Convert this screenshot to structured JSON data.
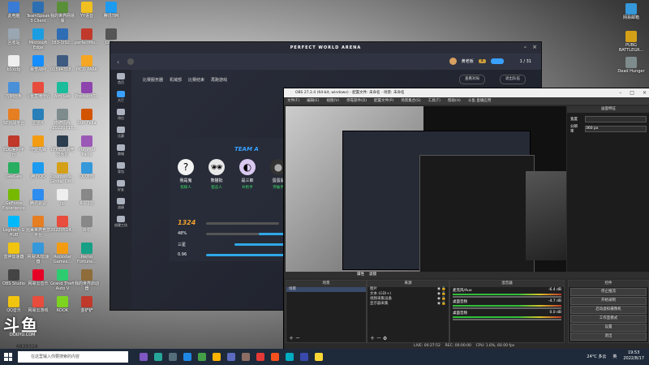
{
  "desktop": {
    "left_icons": [
      {
        "label": "此电脑",
        "color": "#3a7bd5"
      },
      {
        "label": "TeamSpeak 3 Client",
        "color": "#2c6fb3"
      },
      {
        "label": "我的世界网易版",
        "color": "#5a8f3a"
      },
      {
        "label": "YY语音",
        "color": "#f0c020"
      },
      {
        "label": "腾讯TIM",
        "color": "#1d9bf0"
      },
      {
        "label": "回收站",
        "color": "#9aa6b2"
      },
      {
        "label": "Microsoft Edge",
        "color": "#1b9de2"
      },
      {
        "label": "383-1f92...",
        "color": "#2f6db5"
      },
      {
        "label": "perfectMo...",
        "color": "#c0392b"
      },
      {
        "label": "Obs...",
        "color": "#555"
      },
      {
        "label": "b1xzlg",
        "color": "#eee"
      },
      {
        "label": "暴雪战网",
        "color": "#148eff"
      },
      {
        "label": "01594318...",
        "color": "#3d5a80"
      },
      {
        "label": "PICO PARK",
        "color": "#f5a623"
      },
      {
        "label": "控制面板",
        "color": "#4a90d9"
      },
      {
        "label": "斗鱼直播伴侣",
        "color": "#e74c3c"
      },
      {
        "label": "Aim Lab",
        "color": "#1abc9c"
      },
      {
        "label": "PrecisionT...",
        "color": "#8e44ad"
      },
      {
        "label": "5E对战平台",
        "color": "#e67e22"
      },
      {
        "label": "迅雷X",
        "color": "#2980b9"
      },
      {
        "label": "南德图片_20220717...",
        "color": "#7f8c8d"
      },
      {
        "label": "Stilt Fella",
        "color": "#d35400"
      },
      {
        "label": "EDG官网平台",
        "color": "#c0392b"
      },
      {
        "label": "守望先锋",
        "color": "#f39c12"
      },
      {
        "label": "CFHD高清竞技大区",
        "color": "#2c3e50"
      },
      {
        "label": "Pummel Party",
        "color": "#9b59b6"
      },
      {
        "label": "GeeGee",
        "color": "#27ae60"
      },
      {
        "label": "腾讯QQ",
        "color": "#1d9bf0"
      },
      {
        "label": "Counter-S... Global Off...",
        "color": "#d4a017"
      },
      {
        "label": "QQ游戏",
        "color": "#3498db"
      },
      {
        "label": "GeForce Experience",
        "color": "#76b900"
      },
      {
        "label": "腾讯会议",
        "color": "#2d8cf0"
      },
      {
        "label": "cp",
        "color": "#eee"
      },
      {
        "label": "R-C (1)",
        "color": "#888"
      },
      {
        "label": "Logitech G HUB",
        "color": "#00b8fc"
      },
      {
        "label": "完美世界竞技平台",
        "color": "#e67e22"
      },
      {
        "label": "20220514...",
        "color": "#e74c3c"
      },
      {
        "label": "R-C",
        "color": "#888"
      },
      {
        "label": "雷神加速器",
        "color": "#f1c40f"
      },
      {
        "label": "网易UU加速器",
        "color": "#3498db"
      },
      {
        "label": "Rockstar Games...",
        "color": "#f39c12"
      },
      {
        "label": "Remo Fortune...",
        "color": "#16a085"
      },
      {
        "label": "OBS Studio",
        "color": "#444"
      },
      {
        "label": "网易云音乐",
        "color": "#e60026"
      },
      {
        "label": "Grand Theft Auto V",
        "color": "#2ecc71"
      },
      {
        "label": "我的世界启动器",
        "color": "#8e6d3a"
      },
      {
        "label": "QQ音乐",
        "color": "#f1c40f"
      },
      {
        "label": "网易云游戏",
        "color": "#e74c3c"
      },
      {
        "label": "KOOK",
        "color": "#7ed321"
      },
      {
        "label": "金铲铲",
        "color": "#c0392b"
      }
    ],
    "right_icons": [
      {
        "label": "网易邮箱",
        "color": "#3498db"
      },
      {
        "label": "PUBG BATTLEGR...",
        "color": "#d4a017"
      },
      {
        "label": "Dead Hunger",
        "color": "#7f8c8d"
      }
    ]
  },
  "pwa": {
    "title": "PERFECT WORLD ARENA",
    "tabs": [
      "比赛服务器",
      "机械部",
      "比赛结束",
      "再跑游戏"
    ],
    "user": "黄老板",
    "level": "4",
    "page_counter": "1 / 31",
    "btn_match": "查看对局",
    "btn_leave": "退出队伍",
    "sidebar": [
      "首页",
      "大厅",
      "排位",
      "比赛",
      "商城",
      "背包",
      "好友",
      "战绩",
      "创建工坊"
    ],
    "team_name": "TEAM A",
    "players": [
      {
        "name": "我是鬼",
        "role": "指挥人",
        "avatar": "?"
      },
      {
        "name": "熊猫批",
        "role": "狙击人",
        "avatar": "🕶"
      },
      {
        "name": "是三郎",
        "role": "补枪手",
        "avatar": "◐"
      },
      {
        "name": "蛋蛋鼠",
        "role": "突破手",
        "avatar": "●"
      }
    ],
    "stats": {
      "elo": "1324",
      "win": "48%",
      "sub": "三星",
      "kd": "0.96"
    },
    "colors": {
      "accent": "#3aa0ff",
      "elo": "#f0a030",
      "bar": "#2fa8e8"
    }
  },
  "obs": {
    "title": "OBS 27.2.4 (64-bit, windows) - 配置文件: 未命名 - 场景: 未命名",
    "menu": [
      "文件(F)",
      "编辑(E)",
      "视图(V)",
      "停靠部件(D)",
      "配置文件(P)",
      "场景集合(S)",
      "工具(T)",
      "帮助(H)",
      "斗鱼 直播应用"
    ],
    "properties_title": "画面特征",
    "prop_label_1": "宽度",
    "prop_label_2": "分辨率",
    "prop_value_2": "360 px",
    "scenes_header": "场景",
    "scene_item": "场景",
    "sources_header": "来源",
    "mixer_header": "混音器",
    "transitions_header": "转场",
    "controls_header": "控件",
    "tab_props": "属性",
    "tab_filters": "滤镜",
    "sources": [
      {
        "name": "图片"
      },
      {
        "name": "文本 (GDI+)"
      },
      {
        "name": "视频采集设备"
      },
      {
        "name": "显示器采集"
      }
    ],
    "audio": [
      {
        "name": "麦克风/Aux",
        "db": "-6.4 dB"
      },
      {
        "name": "桌面音频",
        "db": "-4.7 dB"
      },
      {
        "name": "桌面音频",
        "db": "0.0 dB"
      }
    ],
    "controls": [
      "停止推流",
      "开始录制",
      "启动虚拟摄像机",
      "工作室模式",
      "设置",
      "退出"
    ],
    "status": {
      "live": "LIVE: 00:27:52",
      "rec": "REC: 00:00:00",
      "cpu": "CPU: 1.6%, 60.00 fps"
    }
  },
  "overlay": {
    "logo": "斗鱼",
    "logo_sub": "DOUYU.COM",
    "room": "6839319"
  },
  "taskbar": {
    "search_placeholder": "在这里输入你要搜索的内容",
    "weather": "24°C 多云",
    "ime": "英",
    "time": "19:53",
    "date": "2022/8/17",
    "apps": [
      {
        "color": "#7e57c2"
      },
      {
        "color": "#26a69a"
      },
      {
        "color": "#546e7a"
      },
      {
        "color": "#1e88e5"
      },
      {
        "color": "#43a047"
      },
      {
        "color": "#ffb300"
      },
      {
        "color": "#5c6bc0"
      },
      {
        "color": "#8d6e63"
      },
      {
        "color": "#e53935"
      },
      {
        "color": "#f4511e"
      },
      {
        "color": "#00acc1"
      },
      {
        "color": "#3949ab"
      },
      {
        "color": "#fdd835"
      }
    ]
  }
}
